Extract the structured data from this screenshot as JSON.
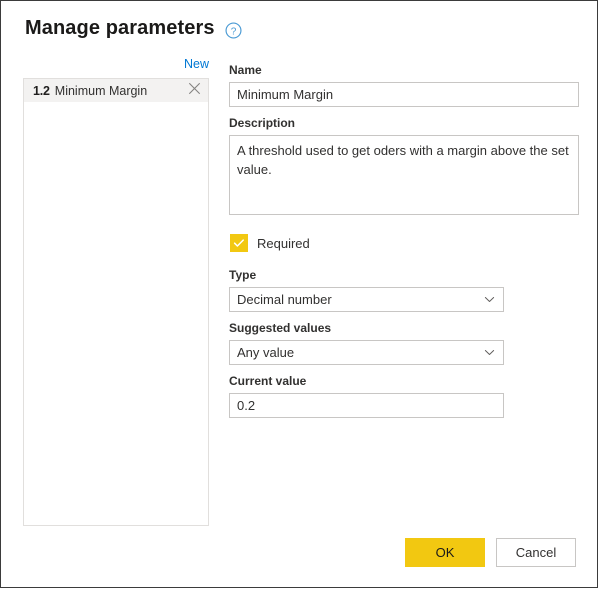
{
  "dialog": {
    "title": "Manage parameters",
    "help_icon": "help-circle-icon",
    "accent_yellow": "#f2c811",
    "link_blue": "#0078d4",
    "border_gray": "#c8c6c4"
  },
  "list_panel": {
    "new_label": "New",
    "items": [
      {
        "type_badge": "1.2",
        "label": "Minimum Margin",
        "close_icon": "close-icon",
        "selected": true
      }
    ]
  },
  "form": {
    "name": {
      "label": "Name",
      "value": "Minimum Margin",
      "placeholder": ""
    },
    "description": {
      "label": "Description",
      "value": "A threshold used to get oders with a margin above the set value.",
      "placeholder": ""
    },
    "required": {
      "label": "Required",
      "checked": true,
      "check_icon": "check-icon"
    },
    "type": {
      "label": "Type",
      "value": "Decimal number",
      "chevron_icon": "chevron-down-icon"
    },
    "suggested_values": {
      "label": "Suggested values",
      "value": "Any value",
      "chevron_icon": "chevron-down-icon"
    },
    "current_value": {
      "label": "Current value",
      "value": "0.2",
      "placeholder": ""
    }
  },
  "footer": {
    "ok_label": "OK",
    "cancel_label": "Cancel"
  }
}
